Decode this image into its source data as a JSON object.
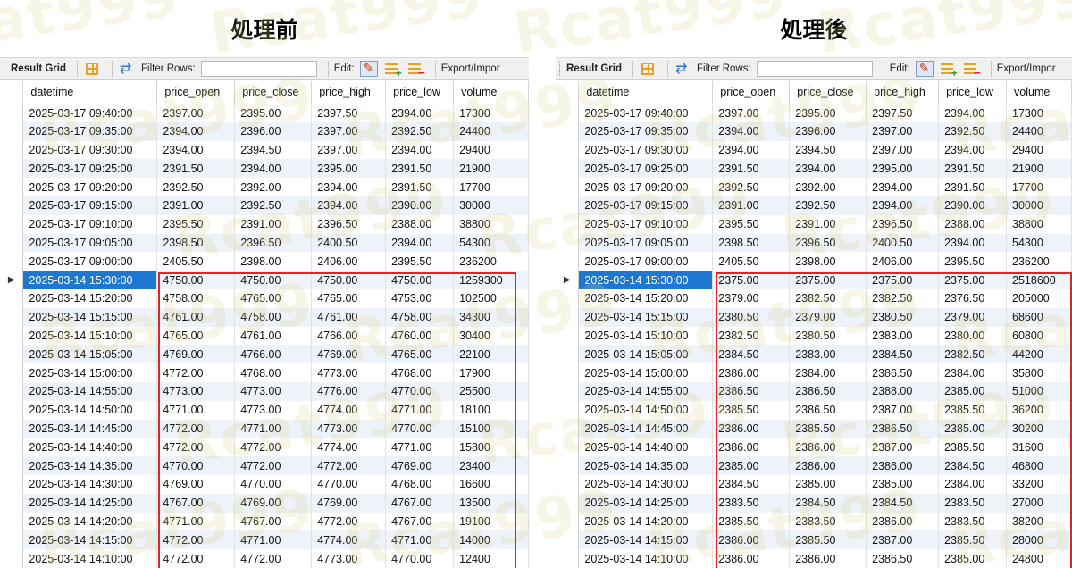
{
  "headings": {
    "before": "処理前",
    "after": "処理後"
  },
  "toolbar": {
    "result_grid": "Result Grid",
    "filter_rows": "Filter Rows:",
    "edit": "Edit:",
    "export": "Export/Impor"
  },
  "watermark_text": "Rcat999",
  "columns": [
    "datetime",
    "price_open",
    "price_close",
    "price_high",
    "price_low",
    "volume"
  ],
  "current_row_marker": "▶",
  "before_rows": [
    [
      "2025-03-17 09:40:00",
      "2397.00",
      "2395.00",
      "2397.50",
      "2394.00",
      "17300"
    ],
    [
      "2025-03-17 09:35:00",
      "2394.00",
      "2396.00",
      "2397.00",
      "2392.50",
      "24400"
    ],
    [
      "2025-03-17 09:30:00",
      "2394.00",
      "2394.50",
      "2397.00",
      "2394.00",
      "29400"
    ],
    [
      "2025-03-17 09:25:00",
      "2391.50",
      "2394.00",
      "2395.00",
      "2391.50",
      "21900"
    ],
    [
      "2025-03-17 09:20:00",
      "2392.50",
      "2392.00",
      "2394.00",
      "2391.50",
      "17700"
    ],
    [
      "2025-03-17 09:15:00",
      "2391.00",
      "2392.50",
      "2394.00",
      "2390.00",
      "30000"
    ],
    [
      "2025-03-17 09:10:00",
      "2395.50",
      "2391.00",
      "2396.50",
      "2388.00",
      "38800"
    ],
    [
      "2025-03-17 09:05:00",
      "2398.50",
      "2396.50",
      "2400.50",
      "2394.00",
      "54300"
    ],
    [
      "2025-03-17 09:00:00",
      "2405.50",
      "2398.00",
      "2406.00",
      "2395.50",
      "236200"
    ],
    [
      "2025-03-14 15:30:00",
      "4750.00",
      "4750.00",
      "4750.00",
      "4750.00",
      "1259300"
    ],
    [
      "2025-03-14 15:20:00",
      "4758.00",
      "4765.00",
      "4765.00",
      "4753.00",
      "102500"
    ],
    [
      "2025-03-14 15:15:00",
      "4761.00",
      "4758.00",
      "4761.00",
      "4758.00",
      "34300"
    ],
    [
      "2025-03-14 15:10:00",
      "4765.00",
      "4761.00",
      "4766.00",
      "4760.00",
      "30400"
    ],
    [
      "2025-03-14 15:05:00",
      "4769.00",
      "4766.00",
      "4769.00",
      "4765.00",
      "22100"
    ],
    [
      "2025-03-14 15:00:00",
      "4772.00",
      "4768.00",
      "4773.00",
      "4768.00",
      "17900"
    ],
    [
      "2025-03-14 14:55:00",
      "4773.00",
      "4773.00",
      "4776.00",
      "4770.00",
      "25500"
    ],
    [
      "2025-03-14 14:50:00",
      "4771.00",
      "4773.00",
      "4774.00",
      "4771.00",
      "18100"
    ],
    [
      "2025-03-14 14:45:00",
      "4772.00",
      "4771.00",
      "4773.00",
      "4770.00",
      "15100"
    ],
    [
      "2025-03-14 14:40:00",
      "4772.00",
      "4772.00",
      "4774.00",
      "4771.00",
      "15800"
    ],
    [
      "2025-03-14 14:35:00",
      "4770.00",
      "4772.00",
      "4772.00",
      "4769.00",
      "23400"
    ],
    [
      "2025-03-14 14:30:00",
      "4769.00",
      "4770.00",
      "4770.00",
      "4768.00",
      "16600"
    ],
    [
      "2025-03-14 14:25:00",
      "4767.00",
      "4769.00",
      "4769.00",
      "4767.00",
      "13500"
    ],
    [
      "2025-03-14 14:20:00",
      "4771.00",
      "4767.00",
      "4772.00",
      "4767.00",
      "19100"
    ],
    [
      "2025-03-14 14:15:00",
      "4772.00",
      "4771.00",
      "4774.00",
      "4771.00",
      "14000"
    ],
    [
      "2025-03-14 14:10:00",
      "4772.00",
      "4772.00",
      "4773.00",
      "4770.00",
      "12400"
    ]
  ],
  "after_rows": [
    [
      "2025-03-17 09:40:00",
      "2397.00",
      "2395.00",
      "2397.50",
      "2394.00",
      "17300"
    ],
    [
      "2025-03-17 09:35:00",
      "2394.00",
      "2396.00",
      "2397.00",
      "2392.50",
      "24400"
    ],
    [
      "2025-03-17 09:30:00",
      "2394.00",
      "2394.50",
      "2397.00",
      "2394.00",
      "29400"
    ],
    [
      "2025-03-17 09:25:00",
      "2391.50",
      "2394.00",
      "2395.00",
      "2391.50",
      "21900"
    ],
    [
      "2025-03-17 09:20:00",
      "2392.50",
      "2392.00",
      "2394.00",
      "2391.50",
      "17700"
    ],
    [
      "2025-03-17 09:15:00",
      "2391.00",
      "2392.50",
      "2394.00",
      "2390.00",
      "30000"
    ],
    [
      "2025-03-17 09:10:00",
      "2395.50",
      "2391.00",
      "2396.50",
      "2388.00",
      "38800"
    ],
    [
      "2025-03-17 09:05:00",
      "2398.50",
      "2396.50",
      "2400.50",
      "2394.00",
      "54300"
    ],
    [
      "2025-03-17 09:00:00",
      "2405.50",
      "2398.00",
      "2406.00",
      "2395.50",
      "236200"
    ],
    [
      "2025-03-14 15:30:00",
      "2375.00",
      "2375.00",
      "2375.00",
      "2375.00",
      "2518600"
    ],
    [
      "2025-03-14 15:20:00",
      "2379.00",
      "2382.50",
      "2382.50",
      "2376.50",
      "205000"
    ],
    [
      "2025-03-14 15:15:00",
      "2380.50",
      "2379.00",
      "2380.50",
      "2379.00",
      "68600"
    ],
    [
      "2025-03-14 15:10:00",
      "2382.50",
      "2380.50",
      "2383.00",
      "2380.00",
      "60800"
    ],
    [
      "2025-03-14 15:05:00",
      "2384.50",
      "2383.00",
      "2384.50",
      "2382.50",
      "44200"
    ],
    [
      "2025-03-14 15:00:00",
      "2386.00",
      "2384.00",
      "2386.50",
      "2384.00",
      "35800"
    ],
    [
      "2025-03-14 14:55:00",
      "2386.50",
      "2386.50",
      "2388.00",
      "2385.00",
      "51000"
    ],
    [
      "2025-03-14 14:50:00",
      "2385.50",
      "2386.50",
      "2387.00",
      "2385.50",
      "36200"
    ],
    [
      "2025-03-14 14:45:00",
      "2386.00",
      "2385.50",
      "2386.50",
      "2385.00",
      "30200"
    ],
    [
      "2025-03-14 14:40:00",
      "2386.00",
      "2386.00",
      "2387.00",
      "2385.50",
      "31600"
    ],
    [
      "2025-03-14 14:35:00",
      "2385.00",
      "2386.00",
      "2386.00",
      "2384.50",
      "46800"
    ],
    [
      "2025-03-14 14:30:00",
      "2384.50",
      "2385.00",
      "2385.00",
      "2384.00",
      "33200"
    ],
    [
      "2025-03-14 14:25:00",
      "2383.50",
      "2384.50",
      "2384.50",
      "2383.50",
      "27000"
    ],
    [
      "2025-03-14 14:20:00",
      "2385.50",
      "2383.50",
      "2386.00",
      "2383.50",
      "38200"
    ],
    [
      "2025-03-14 14:15:00",
      "2386.00",
      "2385.50",
      "2387.00",
      "2385.50",
      "28000"
    ],
    [
      "2025-03-14 14:10:00",
      "2386.00",
      "2386.00",
      "2386.50",
      "2385.00",
      "24800"
    ]
  ],
  "colors": {
    "selection": "#1e78d2",
    "highlight_border": "#e02424",
    "alt_row": "#eef3fa",
    "watermark": "#dcd08c"
  }
}
